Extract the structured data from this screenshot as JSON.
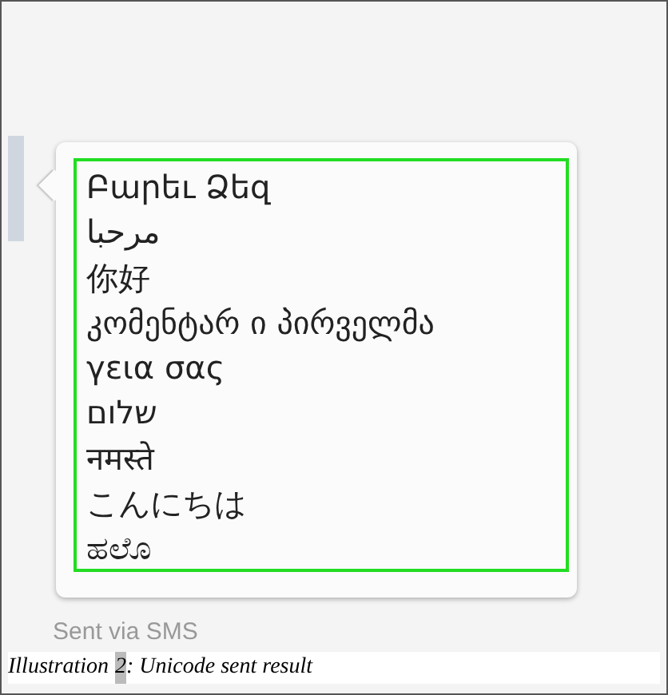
{
  "message": {
    "lines": [
      "Բարեւ Ձեզ",
      "مرحبا",
      "你好",
      "კომენტარ ი პირველმა",
      "γεια σας",
      "שלום",
      "नमस्ते",
      "こんにちは",
      "ಹಲೊ"
    ],
    "status": "Sent via SMS"
  },
  "caption": {
    "label": "Illustration",
    "number": "2",
    "text": ": Unicode sent result"
  }
}
